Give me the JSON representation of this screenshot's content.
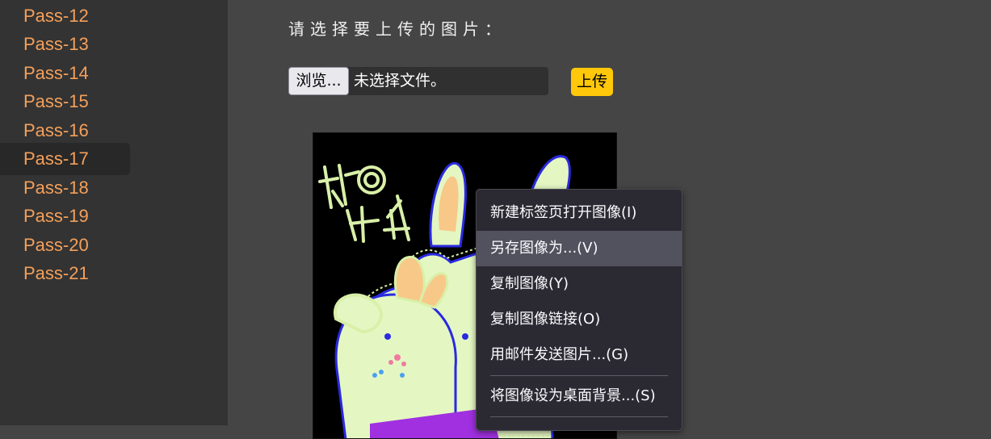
{
  "sidebar": {
    "items": [
      {
        "label": "Pass-12"
      },
      {
        "label": "Pass-13"
      },
      {
        "label": "Pass-14"
      },
      {
        "label": "Pass-15"
      },
      {
        "label": "Pass-16"
      },
      {
        "label": "Pass-17",
        "active": true
      },
      {
        "label": "Pass-18"
      },
      {
        "label": "Pass-19"
      },
      {
        "label": "Pass-20"
      },
      {
        "label": "Pass-21"
      }
    ]
  },
  "upload": {
    "prompt": "请选择要上传的图片：",
    "browse_label": "浏览...",
    "file_status": "未选择文件。",
    "upload_label": "上传"
  },
  "context_menu": {
    "items": [
      {
        "label": "新建标签页打开图像(I)"
      },
      {
        "label": "另存图像为...(V)",
        "highlighted": true
      },
      {
        "label": "复制图像(Y)"
      },
      {
        "label": "复制图像链接(O)"
      },
      {
        "label": "用邮件发送图片...(G)"
      },
      {
        "label": "将图像设为桌面背景...(S)"
      }
    ]
  },
  "colors": {
    "accent_link": "#f5a05a",
    "upload_button": "#ffc80a",
    "menu_background": "#2b2a33",
    "menu_highlight": "#52525e"
  }
}
